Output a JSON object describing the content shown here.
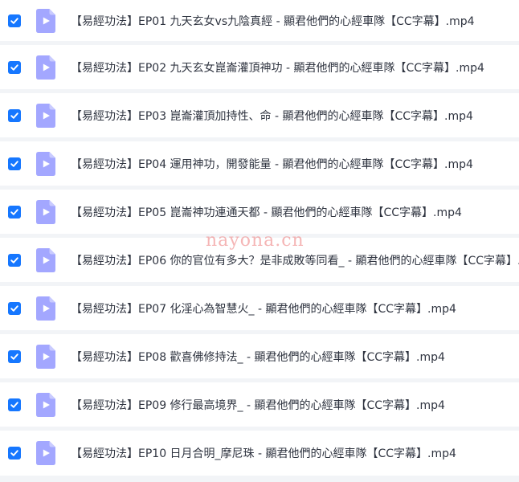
{
  "files": [
    {
      "name": "【易經功法】EP01 九天玄女vs九陰真經 - 顯君他們的心經車隊【CC字幕】.mp4",
      "checked": true,
      "icon": "video-file-icon"
    },
    {
      "name": "【易經功法】EP02 九天玄女崑崙灌頂神功 - 顯君他們的心經車隊【CC字幕】.mp4",
      "checked": true,
      "icon": "video-file-icon"
    },
    {
      "name": "【易經功法】EP03 崑崙灌頂加持性、命 - 顯君他們的心經車隊【CC字幕】.mp4",
      "checked": true,
      "icon": "video-file-icon"
    },
    {
      "name": "【易經功法】EP04 運用神功，開發能量 - 顯君他們的心經車隊【CC字幕】.mp4",
      "checked": true,
      "icon": "video-file-icon"
    },
    {
      "name": "【易經功法】EP05 崑崙神功連通天都 - 顯君他們的心經車隊【CC字幕】.mp4",
      "checked": true,
      "icon": "video-file-icon"
    },
    {
      "name": "【易經功法】EP06 你的官位有多大？是非成敗等同看_ - 顯君他們的心經車隊【CC字幕】.mp4",
      "checked": true,
      "icon": "video-file-icon"
    },
    {
      "name": "【易經功法】EP07 化淫心為智慧火_ - 顯君他們的心經車隊【CC字幕】.mp4",
      "checked": true,
      "icon": "video-file-icon"
    },
    {
      "name": "【易經功法】EP08 歡喜佛修持法_ - 顯君他們的心經車隊【CC字幕】.mp4",
      "checked": true,
      "icon": "video-file-icon"
    },
    {
      "name": "【易經功法】EP09 修行最高境界_ - 顯君他們的心經車隊【CC字幕】.mp4",
      "checked": true,
      "icon": "video-file-icon"
    },
    {
      "name": "【易經功法】EP10 日月合明_摩尼珠  - 顯君他們的心經車隊【CC字幕】.mp4",
      "checked": true,
      "icon": "video-file-icon"
    }
  ],
  "watermark": "nayona.cn",
  "colors": {
    "checkbox": "#1677ff",
    "file_icon": "#a3a7ff",
    "row_background": "#ffffff",
    "separator": "#f2f4f7",
    "text": "#2f3440"
  }
}
